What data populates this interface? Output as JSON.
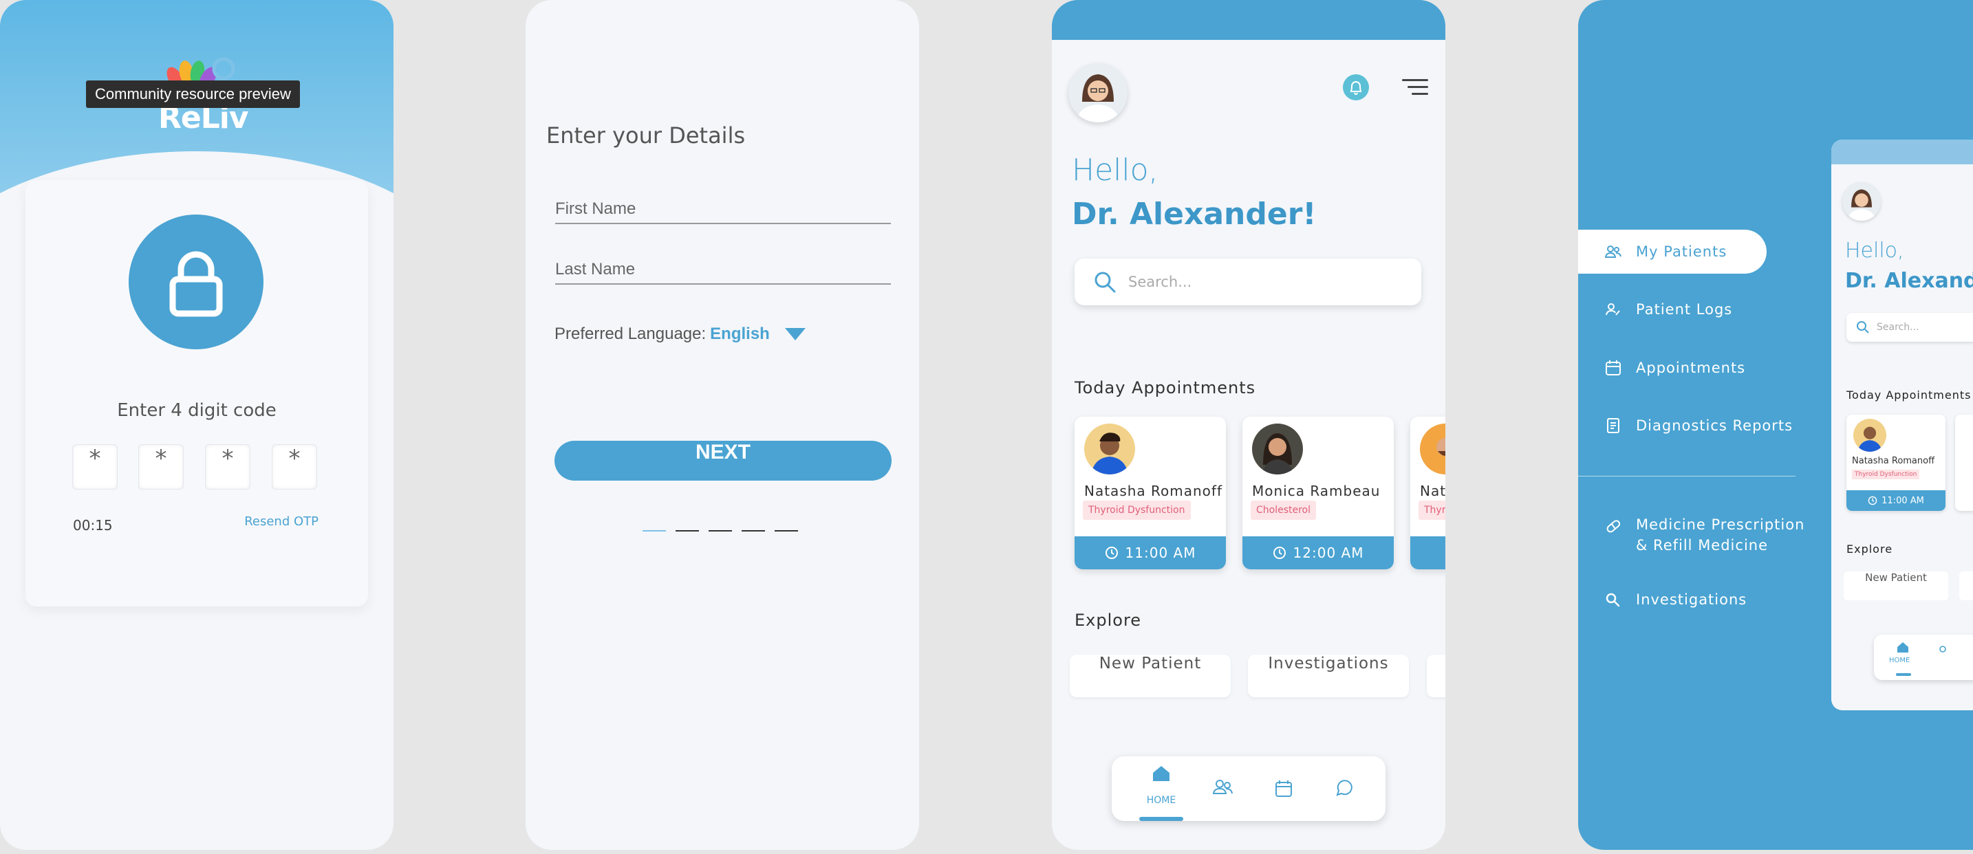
{
  "colors": {
    "primary": "#4aa3d2",
    "background": "#f4f6fa",
    "tag_bg": "#fde4e6",
    "tag_text": "#e0607a"
  },
  "screen_otp": {
    "logo_text": "ReLiv",
    "tooltip": "Community resource preview",
    "lock_icon": "lock-icon",
    "code_label": "Enter 4 digit code",
    "digits": [
      "*",
      "*",
      "*",
      "*"
    ],
    "timer": "00:15",
    "resend": "Resend OTP"
  },
  "screen_details": {
    "title": "Enter your Details",
    "first_name_placeholder": "First Name",
    "last_name_placeholder": "Last Name",
    "language_label": "Preferred Language:",
    "language_value": "English",
    "next_label": "NEXT",
    "steps_total": 5,
    "step_active": 1
  },
  "screen_home": {
    "greeting": "Hello,",
    "doctor_name": "Dr. Alexander!",
    "search_placeholder": "Search...",
    "appointments_title": "Today Appointments",
    "appointments": [
      {
        "name": "Natasha Romanoff",
        "condition": "Thyroid Dysfunction",
        "time": "11:00 AM"
      },
      {
        "name": "Monica Rambeau",
        "condition": "Cholesterol",
        "time": "12:00 AM"
      },
      {
        "name": "Nat",
        "condition": "Thyro",
        "time": ""
      }
    ],
    "explore_title": "Explore",
    "explore_items": [
      "New Patient",
      "Investigations"
    ],
    "nav": {
      "home_label": "HOME",
      "icons": [
        "home-icon",
        "patients-icon",
        "calendar-icon",
        "chat-icon"
      ]
    }
  },
  "screen_menu": {
    "items": [
      {
        "label": "My Patients",
        "icon": "patients-icon",
        "active": true
      },
      {
        "label": "Patient Logs",
        "icon": "patient-logs-icon",
        "active": false
      },
      {
        "label": "Appointments",
        "icon": "calendar-icon",
        "active": false
      },
      {
        "label": "Diagnostics Reports",
        "icon": "report-icon",
        "active": false
      }
    ],
    "secondary_items": [
      {
        "label_line1": "Medicine Prescription",
        "label_line2": "& Refill Medicine",
        "icon": "pill-icon"
      },
      {
        "label": "Investigations",
        "icon": "search-icon"
      }
    ],
    "preview": {
      "greeting": "Hello,",
      "doctor_name": "Dr. Alexander!",
      "search_placeholder": "Search...",
      "appointments_title": "Today Appointments",
      "appt_name": "Natasha Romanoff",
      "appt_condition": "Thyroid Dysfunction",
      "appt_time": "11:00 AM",
      "explore_title": "Explore",
      "explore_item": "New Patient",
      "home_label": "HOME"
    }
  }
}
